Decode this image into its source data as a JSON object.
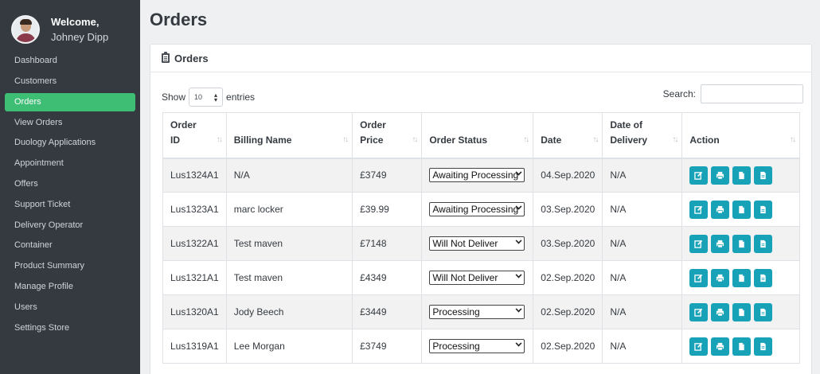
{
  "user": {
    "welcome": "Welcome,",
    "name": "Johney Dipp"
  },
  "sidebar": {
    "items": [
      {
        "label": "Dashboard"
      },
      {
        "label": "Customers"
      },
      {
        "label": "Orders",
        "active": true
      },
      {
        "label": "View Orders"
      },
      {
        "label": "Duology Applications"
      },
      {
        "label": "Appointment"
      },
      {
        "label": "Offers"
      },
      {
        "label": "Support Ticket"
      },
      {
        "label": "Delivery Operator"
      },
      {
        "label": "Container"
      },
      {
        "label": "Product Summary"
      },
      {
        "label": "Manage Profile"
      },
      {
        "label": "Users"
      },
      {
        "label": "Settings Store"
      }
    ]
  },
  "page": {
    "title": "Orders"
  },
  "card": {
    "title": "Orders"
  },
  "controls": {
    "show_label": "Show",
    "entries_value": "10",
    "entries_label": "entries",
    "search_label": "Search:",
    "search_value": ""
  },
  "table": {
    "headers": {
      "order_id_1": "Order",
      "order_id_2": "ID",
      "billing_name": "Billing Name",
      "order_price_1": "Order",
      "order_price_2": "Price",
      "order_status": "Order Status",
      "date": "Date",
      "delivery_1": "Date of",
      "delivery_2": "Delivery",
      "action": "Action"
    },
    "rows": [
      {
        "id": "Lus1324A1",
        "name": "N/A",
        "price": "£3749",
        "status": "Awaiting Processing",
        "date": "04.Sep.2020",
        "delivery": "N/A"
      },
      {
        "id": "Lus1323A1",
        "name": "marc locker",
        "price": "£39.99",
        "status": "Awaiting Processing",
        "date": "03.Sep.2020",
        "delivery": "N/A"
      },
      {
        "id": "Lus1322A1",
        "name": "Test maven",
        "price": "£7148",
        "status": "Will Not Deliver",
        "date": "03.Sep.2020",
        "delivery": "N/A"
      },
      {
        "id": "Lus1321A1",
        "name": "Test maven",
        "price": "£4349",
        "status": "Will Not Deliver",
        "date": "02.Sep.2020",
        "delivery": "N/A"
      },
      {
        "id": "Lus1320A1",
        "name": "Jody Beech",
        "price": "£3449",
        "status": "Processing",
        "date": "02.Sep.2020",
        "delivery": "N/A"
      },
      {
        "id": "Lus1319A1",
        "name": "Lee Morgan",
        "price": "£3749",
        "status": "Processing",
        "date": "02.Sep.2020",
        "delivery": "N/A"
      }
    ]
  },
  "colors": {
    "sidebar_bg": "#343a40",
    "active_nav": "#3ebd74",
    "action_btn": "#17a2b8"
  },
  "icons": {
    "action_buttons": [
      "edit-icon",
      "print-icon",
      "document-icon",
      "file-icon"
    ]
  }
}
